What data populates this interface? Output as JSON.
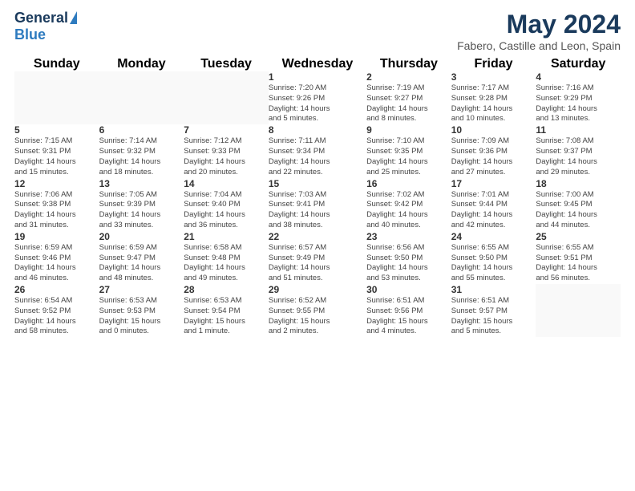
{
  "logo": {
    "general": "General",
    "blue": "Blue"
  },
  "title": "May 2024",
  "subtitle": "Fabero, Castille and Leon, Spain",
  "weekdays": [
    "Sunday",
    "Monday",
    "Tuesday",
    "Wednesday",
    "Thursday",
    "Friday",
    "Saturday"
  ],
  "weeks": [
    [
      {
        "day": "",
        "info": ""
      },
      {
        "day": "",
        "info": ""
      },
      {
        "day": "",
        "info": ""
      },
      {
        "day": "1",
        "info": "Sunrise: 7:20 AM\nSunset: 9:26 PM\nDaylight: 14 hours\nand 5 minutes."
      },
      {
        "day": "2",
        "info": "Sunrise: 7:19 AM\nSunset: 9:27 PM\nDaylight: 14 hours\nand 8 minutes."
      },
      {
        "day": "3",
        "info": "Sunrise: 7:17 AM\nSunset: 9:28 PM\nDaylight: 14 hours\nand 10 minutes."
      },
      {
        "day": "4",
        "info": "Sunrise: 7:16 AM\nSunset: 9:29 PM\nDaylight: 14 hours\nand 13 minutes."
      }
    ],
    [
      {
        "day": "5",
        "info": "Sunrise: 7:15 AM\nSunset: 9:31 PM\nDaylight: 14 hours\nand 15 minutes."
      },
      {
        "day": "6",
        "info": "Sunrise: 7:14 AM\nSunset: 9:32 PM\nDaylight: 14 hours\nand 18 minutes."
      },
      {
        "day": "7",
        "info": "Sunrise: 7:12 AM\nSunset: 9:33 PM\nDaylight: 14 hours\nand 20 minutes."
      },
      {
        "day": "8",
        "info": "Sunrise: 7:11 AM\nSunset: 9:34 PM\nDaylight: 14 hours\nand 22 minutes."
      },
      {
        "day": "9",
        "info": "Sunrise: 7:10 AM\nSunset: 9:35 PM\nDaylight: 14 hours\nand 25 minutes."
      },
      {
        "day": "10",
        "info": "Sunrise: 7:09 AM\nSunset: 9:36 PM\nDaylight: 14 hours\nand 27 minutes."
      },
      {
        "day": "11",
        "info": "Sunrise: 7:08 AM\nSunset: 9:37 PM\nDaylight: 14 hours\nand 29 minutes."
      }
    ],
    [
      {
        "day": "12",
        "info": "Sunrise: 7:06 AM\nSunset: 9:38 PM\nDaylight: 14 hours\nand 31 minutes."
      },
      {
        "day": "13",
        "info": "Sunrise: 7:05 AM\nSunset: 9:39 PM\nDaylight: 14 hours\nand 33 minutes."
      },
      {
        "day": "14",
        "info": "Sunrise: 7:04 AM\nSunset: 9:40 PM\nDaylight: 14 hours\nand 36 minutes."
      },
      {
        "day": "15",
        "info": "Sunrise: 7:03 AM\nSunset: 9:41 PM\nDaylight: 14 hours\nand 38 minutes."
      },
      {
        "day": "16",
        "info": "Sunrise: 7:02 AM\nSunset: 9:42 PM\nDaylight: 14 hours\nand 40 minutes."
      },
      {
        "day": "17",
        "info": "Sunrise: 7:01 AM\nSunset: 9:44 PM\nDaylight: 14 hours\nand 42 minutes."
      },
      {
        "day": "18",
        "info": "Sunrise: 7:00 AM\nSunset: 9:45 PM\nDaylight: 14 hours\nand 44 minutes."
      }
    ],
    [
      {
        "day": "19",
        "info": "Sunrise: 6:59 AM\nSunset: 9:46 PM\nDaylight: 14 hours\nand 46 minutes."
      },
      {
        "day": "20",
        "info": "Sunrise: 6:59 AM\nSunset: 9:47 PM\nDaylight: 14 hours\nand 48 minutes."
      },
      {
        "day": "21",
        "info": "Sunrise: 6:58 AM\nSunset: 9:48 PM\nDaylight: 14 hours\nand 49 minutes."
      },
      {
        "day": "22",
        "info": "Sunrise: 6:57 AM\nSunset: 9:49 PM\nDaylight: 14 hours\nand 51 minutes."
      },
      {
        "day": "23",
        "info": "Sunrise: 6:56 AM\nSunset: 9:50 PM\nDaylight: 14 hours\nand 53 minutes."
      },
      {
        "day": "24",
        "info": "Sunrise: 6:55 AM\nSunset: 9:50 PM\nDaylight: 14 hours\nand 55 minutes."
      },
      {
        "day": "25",
        "info": "Sunrise: 6:55 AM\nSunset: 9:51 PM\nDaylight: 14 hours\nand 56 minutes."
      }
    ],
    [
      {
        "day": "26",
        "info": "Sunrise: 6:54 AM\nSunset: 9:52 PM\nDaylight: 14 hours\nand 58 minutes."
      },
      {
        "day": "27",
        "info": "Sunrise: 6:53 AM\nSunset: 9:53 PM\nDaylight: 15 hours\nand 0 minutes."
      },
      {
        "day": "28",
        "info": "Sunrise: 6:53 AM\nSunset: 9:54 PM\nDaylight: 15 hours\nand 1 minute."
      },
      {
        "day": "29",
        "info": "Sunrise: 6:52 AM\nSunset: 9:55 PM\nDaylight: 15 hours\nand 2 minutes."
      },
      {
        "day": "30",
        "info": "Sunrise: 6:51 AM\nSunset: 9:56 PM\nDaylight: 15 hours\nand 4 minutes."
      },
      {
        "day": "31",
        "info": "Sunrise: 6:51 AM\nSunset: 9:57 PM\nDaylight: 15 hours\nand 5 minutes."
      },
      {
        "day": "",
        "info": ""
      }
    ]
  ]
}
